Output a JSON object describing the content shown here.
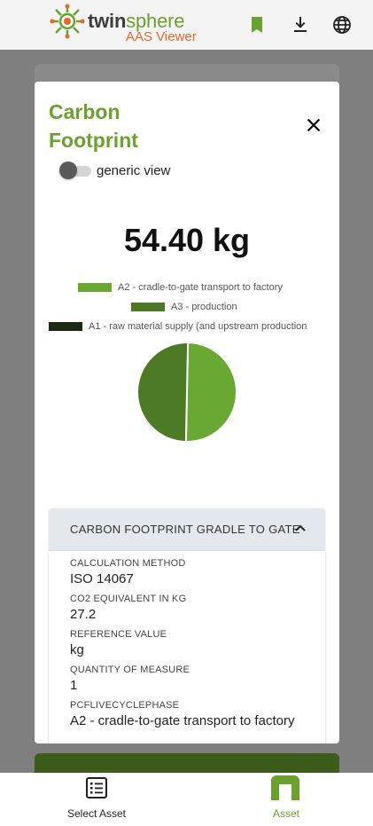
{
  "header": {
    "logo_word_1": "twin",
    "logo_word_2": "sphere",
    "logo_subtitle": "AAS Viewer",
    "icons": [
      "bookmark-icon",
      "download-icon",
      "globe-icon"
    ]
  },
  "dialog": {
    "title": "Carbon Footprint",
    "toggle_label": "generic view",
    "toggle_on": false,
    "total": "54.40 kg"
  },
  "chart_data": {
    "type": "pie",
    "legend": [
      {
        "name": "A2 - cradle-to-gate transport to factory",
        "color": "#6aa834"
      },
      {
        "name": "A3 - production",
        "color": "#4d7a24"
      },
      {
        "name": "A1 - raw material supply (and upstream production",
        "color": "#1b2a10"
      }
    ],
    "slices": [
      {
        "name": "A2 - cradle-to-gate transport to factory",
        "value": 27.2,
        "color": "#6aa834"
      },
      {
        "name": "A3 - production",
        "value": 27.2,
        "color": "#4d7a24"
      },
      {
        "name": "A1 - raw material supply (and upstream production",
        "value": 0,
        "color": "#1b2a10"
      }
    ]
  },
  "accordion": {
    "title": "CARBON FOOTPRINT GRADLE TO GATE",
    "expanded": true,
    "properties": [
      {
        "label": "CALCULATION METHOD",
        "value": "ISO 14067"
      },
      {
        "label": "CO2 EQUIVALENT IN KG",
        "value": "27.2"
      },
      {
        "label": "REFERENCE VALUE",
        "value": "kg"
      },
      {
        "label": "QUANTITY OF MEASURE",
        "value": "1"
      },
      {
        "label": "PCFLIVECYCLEPHASE",
        "value": "A2 - cradle-to-gate transport to factory"
      }
    ]
  },
  "bottom_nav": {
    "items": [
      {
        "label": "Select Asset",
        "icon": "list-icon",
        "active": false
      },
      {
        "label": "Asset",
        "icon": "asset-icon",
        "active": true
      }
    ],
    "active_color": "#6aa12f"
  }
}
